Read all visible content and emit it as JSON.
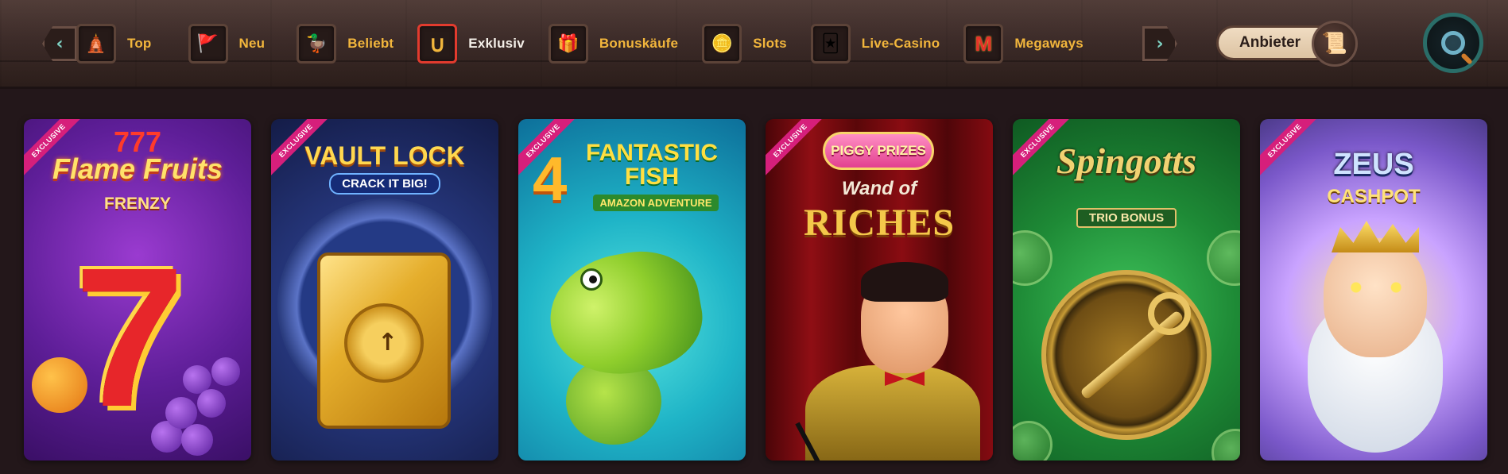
{
  "nav": {
    "left_arrow": "‹",
    "right_arrow": "›",
    "items": [
      {
        "label": "Top",
        "icon": "🛕"
      },
      {
        "label": "Neu",
        "icon": "🚩"
      },
      {
        "label": "Beliebt",
        "icon": "🦆"
      },
      {
        "label": "Exklusiv",
        "icon": "∪"
      },
      {
        "label": "Bonuskäufe",
        "icon": "🎁"
      },
      {
        "label": "Slots",
        "icon": "🪙"
      },
      {
        "label": "Live-Casino",
        "icon": "🃏"
      },
      {
        "label": "Megaways",
        "icon": "M"
      }
    ],
    "active_index": 3
  },
  "provider": {
    "label": "Anbieter",
    "icon": "📜"
  },
  "colors": {
    "nav_label": "#f2b63c",
    "active_border": "#e23b2e",
    "ribbon": "#d61f7b",
    "search_ring": "#2a6d68"
  },
  "cards": [
    {
      "ribbon": "EXCLUSIVE",
      "title_top": "777",
      "title": "Flame Fruits",
      "subtitle": "FRENZY",
      "symbol": "7"
    },
    {
      "ribbon": "EXCLUSIVE",
      "title": "VAULT LOCK",
      "subtitle": "CRACK IT BIG!"
    },
    {
      "ribbon": "EXCLUSIVE",
      "number": "4",
      "title": "FANTASTIC FISH",
      "subtitle": "AMAZON ADVENTURE"
    },
    {
      "ribbon": "EXCLUSIVE",
      "badge": "PIGGY PRIZES",
      "title": "Wand of",
      "subtitle": "RICHES"
    },
    {
      "ribbon": "EXCLUSIVE",
      "title": "Spingotts",
      "subtitle": "TRIO BONUS"
    },
    {
      "ribbon": "EXCLUSIVE",
      "title": "ZEUS",
      "subtitle": "CASHPOT"
    }
  ]
}
